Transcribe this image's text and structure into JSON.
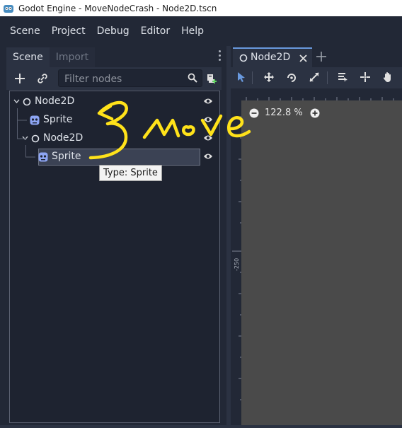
{
  "window": {
    "title": "Godot Engine - MoveNodeCrash - Node2D.tscn"
  },
  "menu": [
    "Scene",
    "Project",
    "Debug",
    "Editor",
    "Help"
  ],
  "dock": {
    "tabs": [
      {
        "label": "Scene",
        "active": true
      },
      {
        "label": "Import",
        "active": false
      }
    ],
    "filter_placeholder": "Filter nodes"
  },
  "tree": {
    "nodes": [
      {
        "label": "Node2D",
        "type": "node2d",
        "depth": 0,
        "expanded": true
      },
      {
        "label": "Sprite",
        "type": "sprite",
        "depth": 1
      },
      {
        "label": "Node2D",
        "type": "node2d",
        "depth": 1,
        "expanded": true
      },
      {
        "label": "Sprite",
        "type": "sprite",
        "depth": 2,
        "selected": true
      }
    ],
    "tooltip": "Type: Sprite"
  },
  "editor": {
    "tab_label": "Node2D",
    "zoom": "122.8 %",
    "ruler_label": "-250"
  },
  "annotation": {
    "text": "Move",
    "color": "#ffe21a"
  },
  "colors": {
    "accent": "#6999de",
    "node_icon": "#dfe3ea",
    "sprite_icon": "#8da5f3"
  }
}
